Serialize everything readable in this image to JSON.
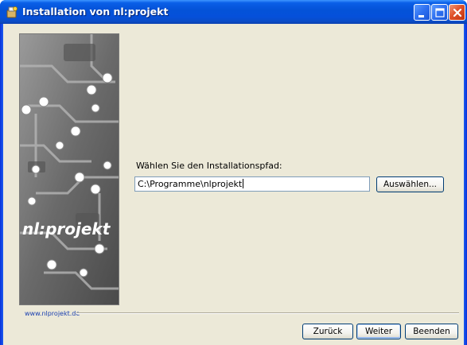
{
  "window": {
    "title": "Installation von nl:projekt"
  },
  "main": {
    "prompt": "Wählen Sie den Installationspfad:",
    "path_value": "C:\\Programme\\nlprojekt",
    "browse_label": "Auswählen..."
  },
  "sidebar_image": {
    "logo_text": "nl:projekt"
  },
  "footer": {
    "link": "www.nlprojekt.de",
    "back_label": "Zurück",
    "next_label": "Weiter",
    "finish_label": "Beenden"
  },
  "colors": {
    "titlebar": "#0453d8",
    "client": "#ece9d8",
    "link": "#1a3fb0"
  },
  "icons": {
    "title": "installer-app-icon",
    "minimize": "minimize-icon",
    "maximize": "maximize-icon",
    "close": "close-icon"
  }
}
